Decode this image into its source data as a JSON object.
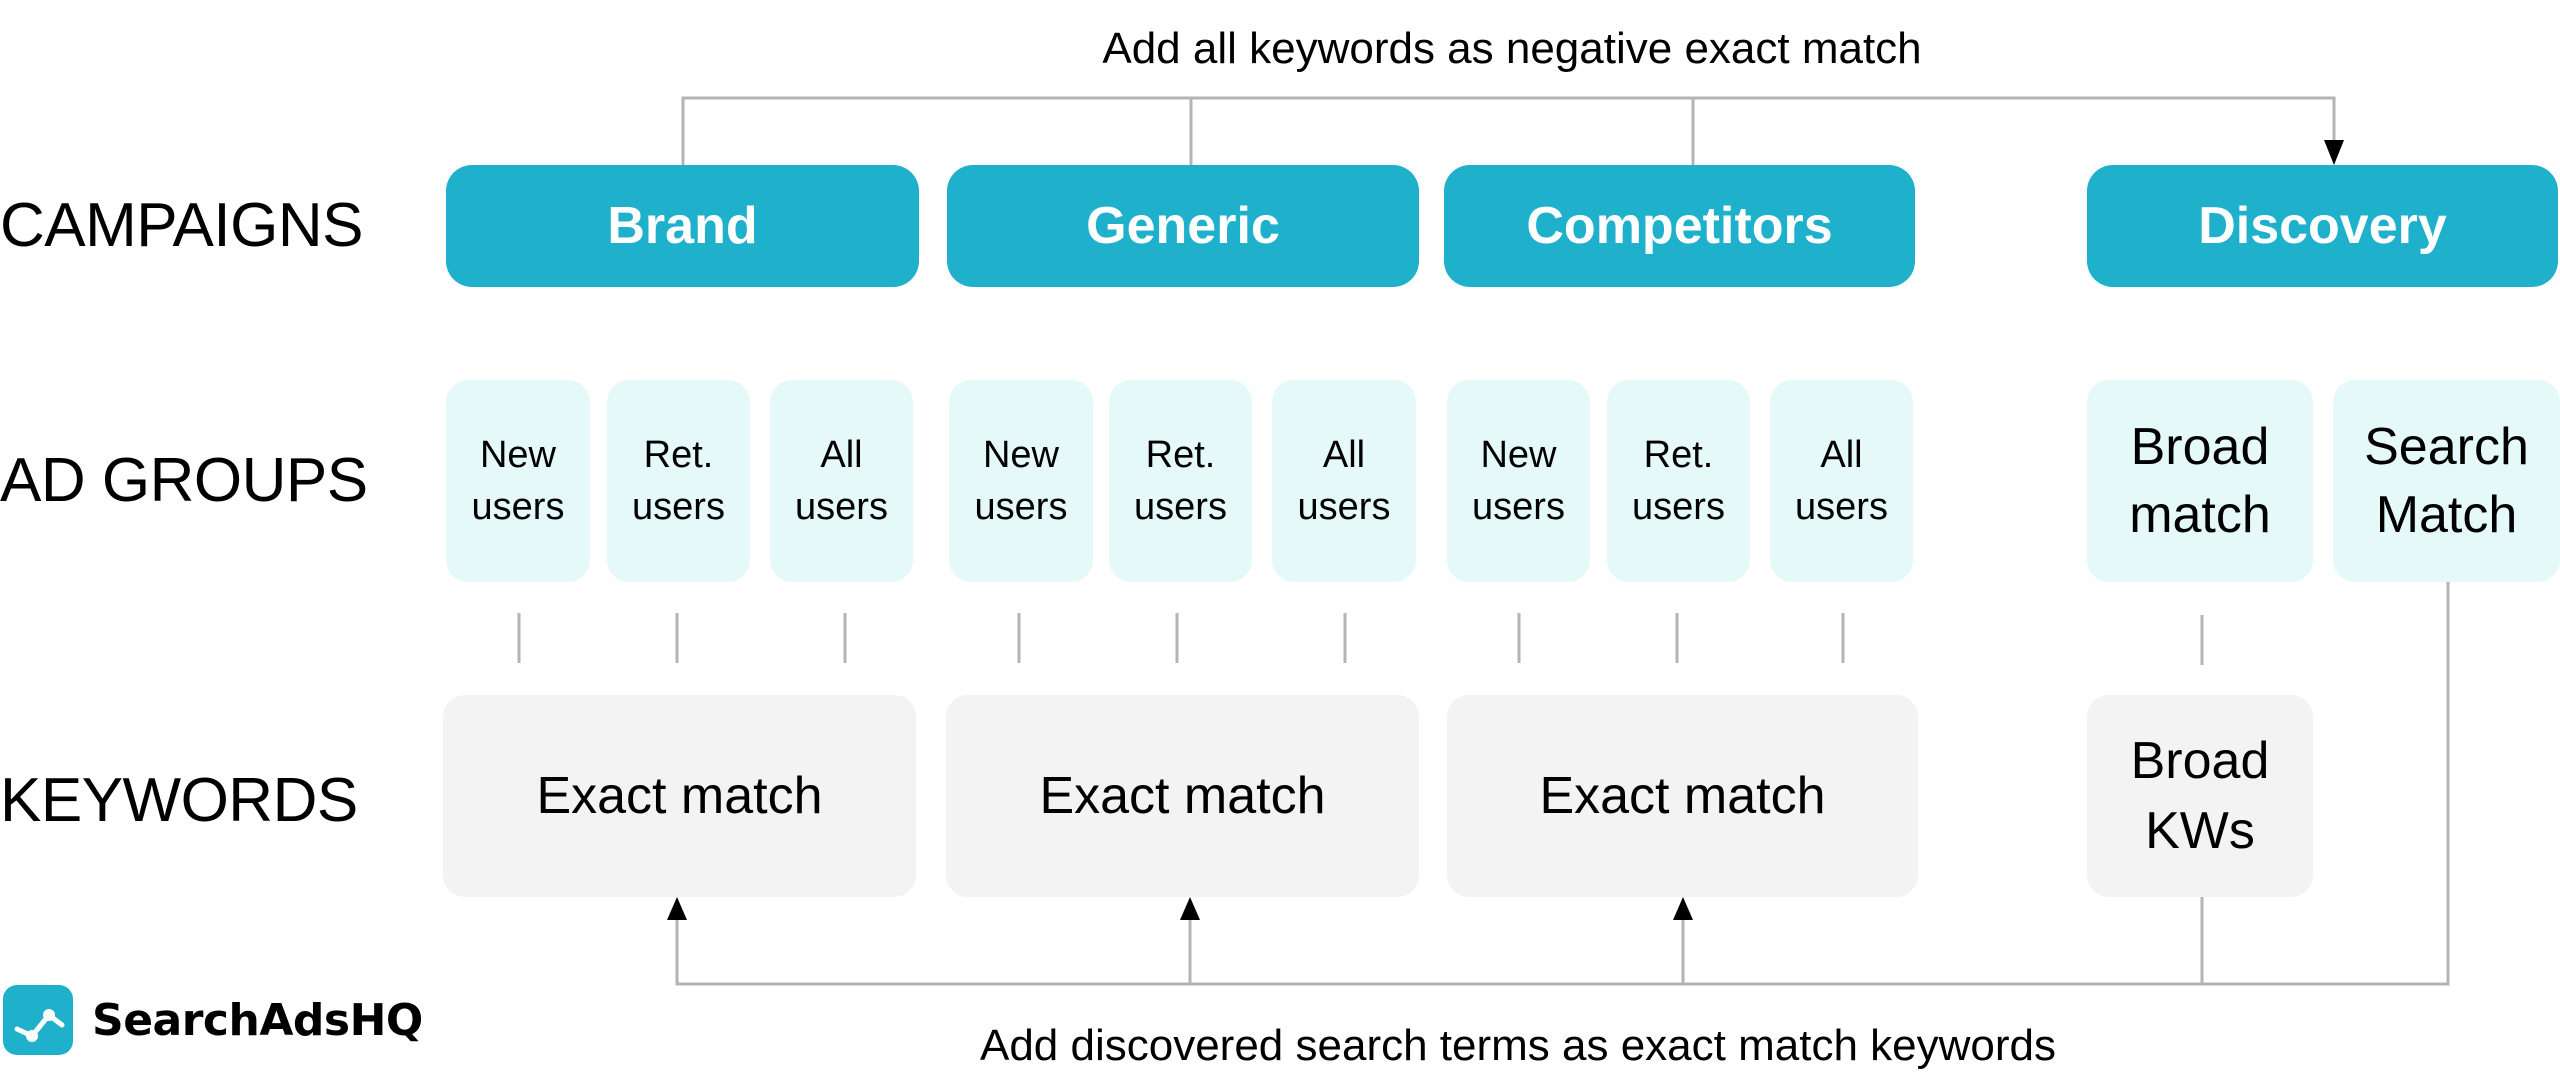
{
  "diagram": {
    "top_note": "Add all keywords as negative exact match",
    "bottom_note": "Add discovered search terms as exact match keywords",
    "row_labels": {
      "campaigns": "CAMPAIGNS",
      "ad_groups": "AD GROUPS",
      "keywords": "KEYWORDS"
    },
    "campaigns": [
      {
        "name": "Brand",
        "ad_groups": [
          "New\nusers",
          "Ret.\nusers",
          "All\nusers"
        ],
        "keywords": "Exact match"
      },
      {
        "name": "Generic",
        "ad_groups": [
          "New\nusers",
          "Ret.\nusers",
          "All\nusers"
        ],
        "keywords": "Exact match"
      },
      {
        "name": "Competitors",
        "ad_groups": [
          "New\nusers",
          "Ret.\nusers",
          "All\nusers"
        ],
        "keywords": "Exact match"
      },
      {
        "name": "Discovery",
        "ad_groups": [
          "Broad\nmatch",
          "Search\nMatch"
        ],
        "keywords": "Broad\nKWs"
      }
    ],
    "colors": {
      "campaign_fill": "#1fb0cc",
      "ad_group_fill": "#e5f9f9",
      "keyword_fill": "#f3f3f3",
      "connector": "#b4b4b4"
    }
  },
  "brand": {
    "name": "SearchAdsHQ",
    "icon": "chart-line-icon"
  }
}
